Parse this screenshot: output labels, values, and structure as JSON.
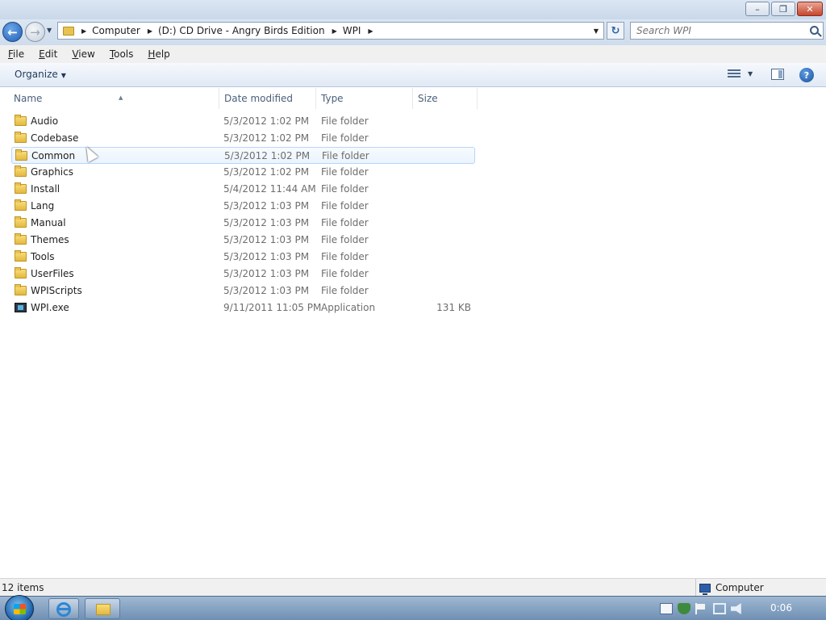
{
  "window": {
    "controls": {
      "minimize": "–",
      "maximize": "❐",
      "close": "✕"
    }
  },
  "nav": {
    "back_icon": "back-arrow-icon",
    "forward_icon": "forward-arrow-icon",
    "breadcrumbs": [
      "Computer",
      "(D:) CD Drive - Angry Birds Edition",
      "WPI"
    ],
    "search_placeholder": "Search WPI"
  },
  "menu": {
    "items": [
      {
        "label": "File",
        "underline": "F"
      },
      {
        "label": "Edit",
        "underline": "E"
      },
      {
        "label": "View",
        "underline": "V"
      },
      {
        "label": "Tools",
        "underline": "T"
      },
      {
        "label": "Help",
        "underline": "H"
      }
    ]
  },
  "toolbar": {
    "organize_label": "Organize"
  },
  "columns": {
    "name": "Name",
    "date": "Date modified",
    "type": "Type",
    "size": "Size"
  },
  "files": [
    {
      "name": "Audio",
      "date": "5/3/2012 1:02 PM",
      "type": "File folder",
      "size": "",
      "icon": "folder-icon"
    },
    {
      "name": "Codebase",
      "date": "5/3/2012 1:02 PM",
      "type": "File folder",
      "size": "",
      "icon": "folder-icon"
    },
    {
      "name": "Common",
      "date": "5/3/2012 1:02 PM",
      "type": "File folder",
      "size": "",
      "icon": "folder-icon"
    },
    {
      "name": "Graphics",
      "date": "5/3/2012 1:02 PM",
      "type": "File folder",
      "size": "",
      "icon": "folder-icon"
    },
    {
      "name": "Install",
      "date": "5/4/2012 11:44 AM",
      "type": "File folder",
      "size": "",
      "icon": "folder-icon"
    },
    {
      "name": "Lang",
      "date": "5/3/2012 1:03 PM",
      "type": "File folder",
      "size": "",
      "icon": "folder-icon"
    },
    {
      "name": "Manual",
      "date": "5/3/2012 1:03 PM",
      "type": "File folder",
      "size": "",
      "icon": "folder-icon"
    },
    {
      "name": "Themes",
      "date": "5/3/2012 1:03 PM",
      "type": "File folder",
      "size": "",
      "icon": "folder-icon"
    },
    {
      "name": "Tools",
      "date": "5/3/2012 1:03 PM",
      "type": "File folder",
      "size": "",
      "icon": "folder-icon"
    },
    {
      "name": "UserFiles",
      "date": "5/3/2012 1:03 PM",
      "type": "File folder",
      "size": "",
      "icon": "folder-icon"
    },
    {
      "name": "WPIScripts",
      "date": "5/3/2012 1:03 PM",
      "type": "File folder",
      "size": "",
      "icon": "folder-icon"
    },
    {
      "name": "WPI.exe",
      "date": "9/11/2011 11:05 PM",
      "type": "Application",
      "size": "131 KB",
      "icon": "application-icon"
    }
  ],
  "hovered_row": "Common",
  "status": {
    "item_count": "12 items",
    "location": "Computer"
  },
  "taskbar": {
    "clock": "0:06"
  },
  "colors": {
    "accent": "#1d5fb8",
    "hover_border": "#b8d6fb",
    "folder": "#e3b83f"
  }
}
